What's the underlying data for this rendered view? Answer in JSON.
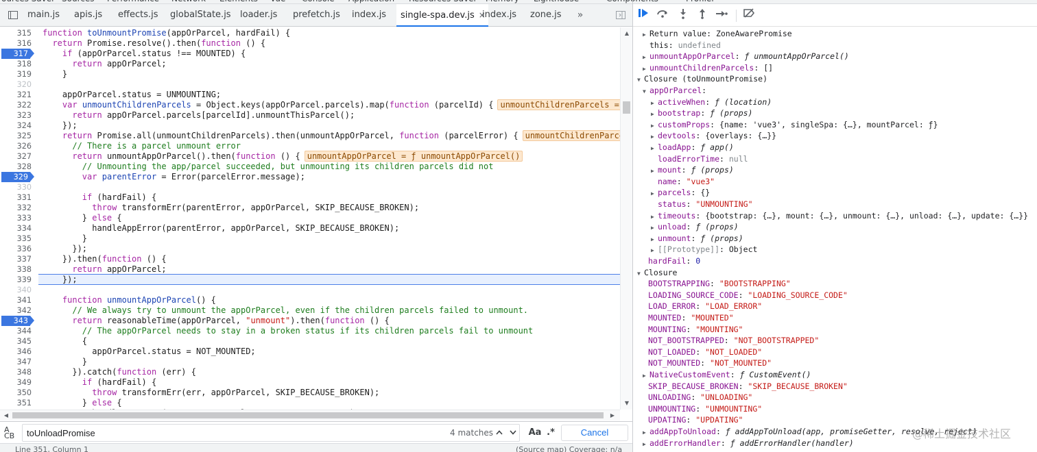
{
  "top_tabs": [
    "ources Saver",
    "Sources",
    "Performance",
    "Network",
    "Elements",
    "Vue",
    "Console",
    "Application",
    "Resources Saver",
    "Memory",
    "Lighthouse",
    "Components",
    "Profiler"
  ],
  "file_tabs": [
    {
      "label": "main.js",
      "active": false
    },
    {
      "label": "apis.js",
      "active": false
    },
    {
      "label": "effects.js",
      "active": false
    },
    {
      "label": "globalState.js",
      "active": false
    },
    {
      "label": "loader.js",
      "active": false
    },
    {
      "label": "prefetch.js",
      "active": false
    },
    {
      "label": "index.js",
      "active": false
    },
    {
      "label": "single-spa.dev.js",
      "active": true,
      "close": "×"
    },
    {
      "label": "index.js",
      "active": false
    },
    {
      "label": "zone.js",
      "active": false
    }
  ],
  "more_tabs_glyph": "»",
  "code": {
    "current_line": 339,
    "lines": [
      {
        "n": "315",
        "t": "function toUnmountPromise(appOrParcel, hardFail) {"
      },
      {
        "n": "316",
        "t": "  return Promise.resolve().then(function () {"
      },
      {
        "n": "317",
        "t": "    if (appOrParcel.status !== MOUNTED) {",
        "bp": true
      },
      {
        "n": "318",
        "t": "      return appOrParcel;"
      },
      {
        "n": "319",
        "t": "    }"
      },
      {
        "n": "320",
        "t": "",
        "light": true
      },
      {
        "n": "321",
        "t": "    appOrParcel.status = UNMOUNTING;"
      },
      {
        "n": "322",
        "t": "    var unmountChildrenParcels = Object.keys(appOrParcel.parcels).map(function (parcelId) {",
        "inline": "unmountChildrenParcels = []"
      },
      {
        "n": "323",
        "t": "      return appOrParcel.parcels[parcelId].unmountThisParcel();"
      },
      {
        "n": "324",
        "t": "    });"
      },
      {
        "n": "325",
        "t": "    return Promise.all(unmountChildrenParcels).then(unmountAppOrParcel, function (parcelError) {",
        "inline": "unmountChildrenParcels ="
      },
      {
        "n": "326",
        "t": "      // There is a parcel unmount error"
      },
      {
        "n": "327",
        "t": "      return unmountAppOrParcel().then(function () {",
        "inline": "unmountAppOrParcel = ƒ unmountAppOrParcel()"
      },
      {
        "n": "328",
        "t": "        // Unmounting the app/parcel succeeded, but unmounting its children parcels did not"
      },
      {
        "n": "329",
        "t": "        var parentError = Error(parcelError.message);",
        "bp": true
      },
      {
        "n": "330",
        "t": "",
        "light": true
      },
      {
        "n": "331",
        "t": "        if (hardFail) {"
      },
      {
        "n": "332",
        "t": "          throw transformErr(parentError, appOrParcel, SKIP_BECAUSE_BROKEN);"
      },
      {
        "n": "333",
        "t": "        } else {"
      },
      {
        "n": "334",
        "t": "          handleAppError(parentError, appOrParcel, SKIP_BECAUSE_BROKEN);"
      },
      {
        "n": "335",
        "t": "        }"
      },
      {
        "n": "336",
        "t": "      });"
      },
      {
        "n": "337",
        "t": "    }).then(function () {"
      },
      {
        "n": "338",
        "t": "      return appOrParcel;"
      },
      {
        "n": "339",
        "t": "    });"
      },
      {
        "n": "340",
        "t": "",
        "light": true
      },
      {
        "n": "341",
        "t": "    function unmountAppOrParcel() {"
      },
      {
        "n": "342",
        "t": "      // We always try to unmount the appOrParcel, even if the children parcels failed to unmount."
      },
      {
        "n": "343",
        "t": "      return reasonableTime(appOrParcel, \"unmount\").then(function () {",
        "bp": true
      },
      {
        "n": "344",
        "t": "        // The appOrParcel needs to stay in a broken status if its children parcels fail to unmount"
      },
      {
        "n": "345",
        "t": "        {"
      },
      {
        "n": "346",
        "t": "          appOrParcel.status = NOT_MOUNTED;"
      },
      {
        "n": "347",
        "t": "        }"
      },
      {
        "n": "348",
        "t": "      }).catch(function (err) {"
      },
      {
        "n": "349",
        "t": "        if (hardFail) {"
      },
      {
        "n": "350",
        "t": "          throw transformErr(err, appOrParcel, SKIP_BECAUSE_BROKEN);"
      },
      {
        "n": "351",
        "t": "        } else {"
      },
      {
        "n": "352",
        "t": "          handleAppError(err, appOrParcel, SKIP_BECAUSE_BROKEN);"
      }
    ]
  },
  "search": {
    "value": "toUnloadPromise",
    "matches": "4 matches",
    "aa": "Aa",
    "regex": ".*",
    "cancel": "Cancel",
    "case_glyph": "A\nCB"
  },
  "status": {
    "left": "Line 351, Column 1",
    "right": "(Source map) Coverage: n/a"
  },
  "scope": [
    {
      "indent": 0,
      "arrow": "right",
      "key": "Return value",
      "keyplain": true,
      "val": "ZoneAwarePromise",
      "vt": "plain"
    },
    {
      "indent": 1,
      "key": "this",
      "keyplain": true,
      "val": "undefined",
      "vt": "gray"
    },
    {
      "indent": 0,
      "arrow": "right",
      "key": "unmountAppOrParcel",
      "val": "ƒ unmountAppOrParcel()",
      "vt": "fn"
    },
    {
      "indent": 0,
      "arrow": "right",
      "key": "unmountChildrenParcels",
      "val": "[]",
      "vt": "plain"
    },
    {
      "indent": -1,
      "arrow": "down",
      "section": "Closure (toUnmountPromise)"
    },
    {
      "indent": 0,
      "arrow": "down",
      "key": "appOrParcel",
      "val": "",
      "vt": "plain"
    },
    {
      "indent": 1,
      "arrow": "right",
      "key": "activeWhen",
      "val": "ƒ (location)",
      "vt": "fn"
    },
    {
      "indent": 1,
      "arrow": "right",
      "key": "bootstrap",
      "val": "ƒ (props)",
      "vt": "fn"
    },
    {
      "indent": 1,
      "arrow": "right",
      "key": "customProps",
      "val": "{name: 'vue3', singleSpa: {…}, mountParcel: ƒ}",
      "vt": "plain"
    },
    {
      "indent": 1,
      "arrow": "right",
      "key": "devtools",
      "val": "{overlays: {…}}",
      "vt": "plain"
    },
    {
      "indent": 1,
      "arrow": "right",
      "key": "loadApp",
      "val": "ƒ app()",
      "vt": "fn"
    },
    {
      "indent": 2,
      "key": "loadErrorTime",
      "val": "null",
      "vt": "gray"
    },
    {
      "indent": 1,
      "arrow": "right",
      "key": "mount",
      "val": "ƒ (props)",
      "vt": "fn"
    },
    {
      "indent": 2,
      "key": "name",
      "val": "\"vue3\"",
      "vt": "str"
    },
    {
      "indent": 1,
      "arrow": "right",
      "key": "parcels",
      "val": "{}",
      "vt": "plain"
    },
    {
      "indent": 2,
      "key": "status",
      "val": "\"UNMOUNTING\"",
      "vt": "str"
    },
    {
      "indent": 1,
      "arrow": "right",
      "key": "timeouts",
      "val": "{bootstrap: {…}, mount: {…}, unmount: {…}, unload: {…}, update: {…}}",
      "vt": "plain"
    },
    {
      "indent": 1,
      "arrow": "right",
      "key": "unload",
      "val": "ƒ (props)",
      "vt": "fn"
    },
    {
      "indent": 1,
      "arrow": "right",
      "key": "unmount",
      "val": "ƒ (props)",
      "vt": "fn"
    },
    {
      "indent": 1,
      "arrow": "right",
      "key": "[[Prototype]]",
      "keygray": true,
      "val": "Object",
      "vt": "plain"
    },
    {
      "indent": 1,
      "key": "hardFail",
      "val": "0",
      "vt": "num",
      "shift": -1
    },
    {
      "indent": -1,
      "arrow": "down",
      "section": "Closure"
    },
    {
      "indent": 1,
      "key": "BOOTSTRAPPING",
      "val": "\"BOOTSTRAPPING\"",
      "vt": "str",
      "shift": -1
    },
    {
      "indent": 1,
      "key": "LOADING_SOURCE_CODE",
      "val": "\"LOADING_SOURCE_CODE\"",
      "vt": "str",
      "shift": -1
    },
    {
      "indent": 1,
      "key": "LOAD_ERROR",
      "val": "\"LOAD_ERROR\"",
      "vt": "str",
      "shift": -1
    },
    {
      "indent": 1,
      "key": "MOUNTED",
      "val": "\"MOUNTED\"",
      "vt": "str",
      "shift": -1
    },
    {
      "indent": 1,
      "key": "MOUNTING",
      "val": "\"MOUNTING\"",
      "vt": "str",
      "shift": -1
    },
    {
      "indent": 1,
      "key": "NOT_BOOTSTRAPPED",
      "val": "\"NOT_BOOTSTRAPPED\"",
      "vt": "str",
      "shift": -1
    },
    {
      "indent": 1,
      "key": "NOT_LOADED",
      "val": "\"NOT_LOADED\"",
      "vt": "str",
      "shift": -1
    },
    {
      "indent": 1,
      "key": "NOT_MOUNTED",
      "val": "\"NOT_MOUNTED\"",
      "vt": "str",
      "shift": -1
    },
    {
      "indent": 0,
      "arrow": "right",
      "key": "NativeCustomEvent",
      "val": "ƒ CustomEvent()",
      "vt": "fn"
    },
    {
      "indent": 1,
      "key": "SKIP_BECAUSE_BROKEN",
      "val": "\"SKIP_BECAUSE_BROKEN\"",
      "vt": "str",
      "shift": -1
    },
    {
      "indent": 1,
      "key": "UNLOADING",
      "val": "\"UNLOADING\"",
      "vt": "str",
      "shift": -1
    },
    {
      "indent": 1,
      "key": "UNMOUNTING",
      "val": "\"UNMOUNTING\"",
      "vt": "str",
      "shift": -1
    },
    {
      "indent": 1,
      "key": "UPDATING",
      "val": "\"UPDATING\"",
      "vt": "str",
      "shift": -1
    },
    {
      "indent": 0,
      "arrow": "right",
      "key": "addAppToUnload",
      "val": "ƒ addAppToUnload(app, promiseGetter, resolve, reject)",
      "vt": "fn"
    },
    {
      "indent": 0,
      "arrow": "right",
      "key": "addErrorHandler",
      "val": "ƒ addErrorHandler(handler)",
      "vt": "fn"
    }
  ],
  "watermark": "@稀土掘金技术社区",
  "icons": {
    "sidebar": "sidebar-toggle-icon",
    "resume": "resume-icon",
    "step_over": "step-over-icon",
    "step_into": "step-into-icon",
    "step_out": "step-out-icon",
    "step": "step-icon",
    "deactivate": "deactivate-breakpoints-icon"
  },
  "colors": {
    "accent": "#1a73e8",
    "breakpoint": "#3b76e0",
    "string": "#c41a16",
    "keyword": "#a626a4",
    "property": "#881391",
    "inline_value_bg": "#fde8cf"
  }
}
